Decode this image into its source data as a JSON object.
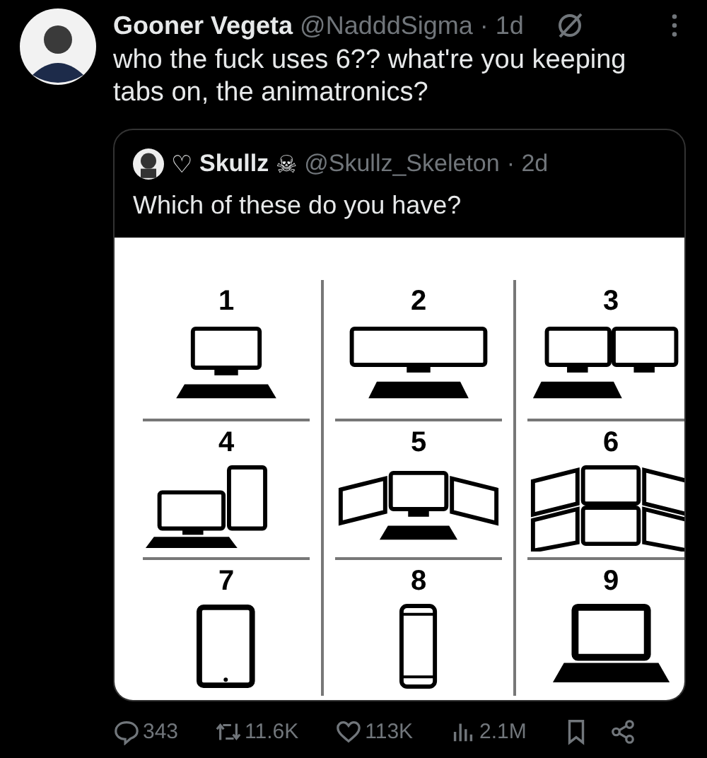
{
  "tweet": {
    "author": {
      "name": "Gooner Vegeta",
      "handle": "@NadddSigma",
      "time": "· 1d"
    },
    "text": "who the fuck uses 6?? what're you keeping tabs on, the animatronics?",
    "quote": {
      "author": {
        "prefix": "♡",
        "name": "Skullz",
        "badge": "☠",
        "handle": "@Skullz_Skeleton",
        "time": "· 2d"
      },
      "text": "Which of these do you have?",
      "image": {
        "options": [
          {
            "number": "1",
            "kind": "monitor"
          },
          {
            "number": "2",
            "kind": "ultrawide"
          },
          {
            "number": "3",
            "kind": "dual"
          },
          {
            "number": "4",
            "kind": "vertical"
          },
          {
            "number": "5",
            "kind": "triple"
          },
          {
            "number": "6",
            "kind": "six"
          },
          {
            "number": "7",
            "kind": "tablet"
          },
          {
            "number": "8",
            "kind": "phone"
          },
          {
            "number": "9",
            "kind": "laptop"
          }
        ]
      }
    },
    "stats": {
      "replies": "343",
      "reposts": "11.6K",
      "likes": "113K",
      "views": "2.1M"
    }
  }
}
